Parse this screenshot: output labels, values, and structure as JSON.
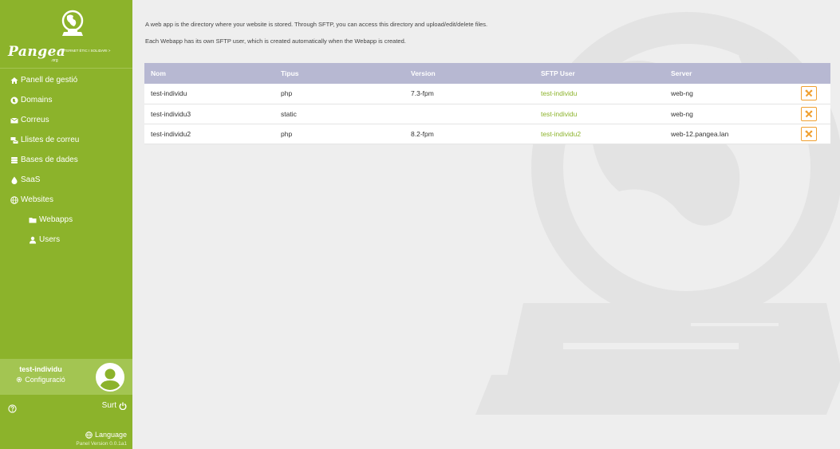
{
  "brand": {
    "name": "Pangea",
    "org": ".org",
    "tagline": "< INTERNET ÈTIC I SOLIDARI >"
  },
  "sidebar": {
    "items": [
      {
        "label": "Panell de gestió",
        "icon": "home-icon"
      },
      {
        "label": "Domains",
        "icon": "globe-circle-icon"
      },
      {
        "label": "Correus",
        "icon": "envelope-icon"
      },
      {
        "label": "Llistes de correu",
        "icon": "mailing-list-icon"
      },
      {
        "label": "Bases de dades",
        "icon": "database-icon"
      },
      {
        "label": "SaaS",
        "icon": "drop-icon"
      },
      {
        "label": "Websites",
        "icon": "globe-icon"
      },
      {
        "label": "Webapps",
        "icon": "folder-icon"
      },
      {
        "label": "Users",
        "icon": "user-icon"
      }
    ],
    "user": {
      "name": "test-individu",
      "config_label": "Configuració"
    },
    "logout_label": "Surt",
    "language_label": "Language",
    "version": "Panel Version 0.0.1a1"
  },
  "main": {
    "intro_line1": "A web app is the directory where your website is stored. Through SFTP, you can access this directory and upload/edit/delete files.",
    "intro_line2": "Each Webapp has its own SFTP user, which is created automatically when the Webapp is created.",
    "table": {
      "headers": [
        "Nom",
        "Tipus",
        "Version",
        "SFTP User",
        "Server"
      ],
      "rows": [
        {
          "nom": "test-individu",
          "tipus": "php",
          "version": "7.3-fpm",
          "sftp_user": "test-individu",
          "server": "web-ng"
        },
        {
          "nom": "test-individu3",
          "tipus": "static",
          "version": "",
          "sftp_user": "test-individu",
          "server": "web-ng"
        },
        {
          "nom": "test-individu2",
          "tipus": "php",
          "version": "8.2-fpm",
          "sftp_user": "test-individu2",
          "server": "web-12.pangea.lan"
        }
      ]
    }
  },
  "colors": {
    "brand_green": "#8cb32b",
    "header_purple": "#b7b8d2",
    "action_orange": "#f0a030"
  }
}
